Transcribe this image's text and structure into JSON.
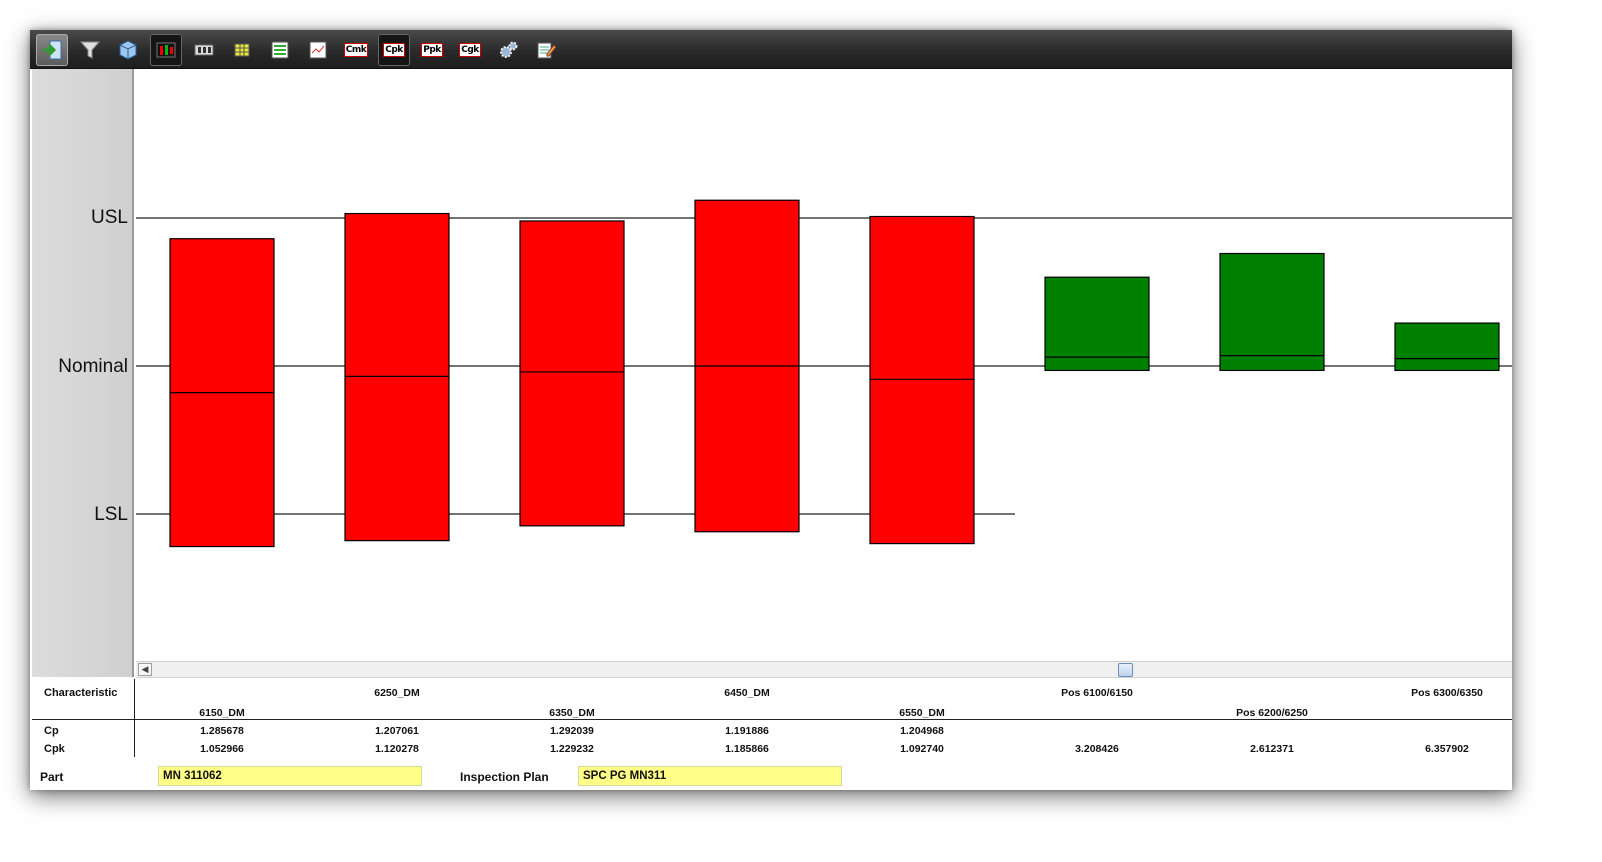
{
  "toolbar": {
    "buttons": [
      {
        "name": "exit-button",
        "icon": "exit-arrow-icon"
      },
      {
        "name": "filter-button",
        "icon": "funnel-icon"
      },
      {
        "name": "cube-button",
        "icon": "cube-icon"
      },
      {
        "name": "box-chart-button",
        "icon": "box-chart-icon"
      },
      {
        "name": "value-chart-button",
        "icon": "value-chart-icon"
      },
      {
        "name": "table-button",
        "icon": "table-icon"
      },
      {
        "name": "list-button",
        "icon": "list-icon"
      },
      {
        "name": "line-chart-button",
        "icon": "line-chart-icon"
      },
      {
        "name": "cmk-button",
        "icon": "cmk-icon",
        "text": "Cmk"
      },
      {
        "name": "cpk-button",
        "icon": "cpk-icon",
        "text": "Cpk"
      },
      {
        "name": "ppk-button",
        "icon": "ppk-icon",
        "text": "Ppk"
      },
      {
        "name": "cgk-button",
        "icon": "cgk-icon",
        "text": "Cgk"
      },
      {
        "name": "settings-button",
        "icon": "gears-icon"
      },
      {
        "name": "edit-button",
        "icon": "notepad-pencil-icon"
      }
    ]
  },
  "chart_data": {
    "type": "box",
    "y_reference_lines": [
      "USL",
      "Nominal",
      "LSL"
    ],
    "scale": {
      "USL": 1,
      "Nominal": 0,
      "LSL": -1
    },
    "colors": {
      "out_of_spec": "#ff0000",
      "in_spec": "#008000"
    },
    "boxes": [
      {
        "characteristic": "6150_DM",
        "low": -1.22,
        "high": 0.86,
        "center": -0.18,
        "status": "out_of_spec"
      },
      {
        "characteristic": "6250_DM",
        "low": -1.18,
        "high": 1.03,
        "center": -0.07,
        "status": "out_of_spec"
      },
      {
        "characteristic": "6350_DM",
        "low": -1.08,
        "high": 0.98,
        "center": -0.04,
        "status": "out_of_spec"
      },
      {
        "characteristic": "6450_DM",
        "low": -1.12,
        "high": 1.12,
        "center": 0.0,
        "status": "out_of_spec"
      },
      {
        "characteristic": "6550_DM",
        "low": -1.2,
        "high": 1.01,
        "center": -0.09,
        "status": "out_of_spec"
      },
      {
        "characteristic": "Pos 6100/6150",
        "low": -0.03,
        "high": 0.6,
        "center": 0.06,
        "status": "in_spec"
      },
      {
        "characteristic": "Pos 6200/6250",
        "low": -0.03,
        "high": 0.76,
        "center": 0.07,
        "status": "in_spec"
      },
      {
        "characteristic": "Pos 6300/6350",
        "low": -0.03,
        "high": 0.29,
        "center": 0.05,
        "status": "in_spec"
      }
    ],
    "lsl_extent_items": 5
  },
  "table": {
    "header_label": "Characteristic",
    "cp_label": "Cp",
    "cpk_label": "Cpk",
    "columns": [
      {
        "name": "6150_DM",
        "cp": "1.285678",
        "cpk": "1.052966"
      },
      {
        "name": "6250_DM",
        "cp": "1.207061",
        "cpk": "1.120278"
      },
      {
        "name": "6350_DM",
        "cp": "1.292039",
        "cpk": "1.229232"
      },
      {
        "name": "6450_DM",
        "cp": "1.191886",
        "cpk": "1.185866"
      },
      {
        "name": "6550_DM",
        "cp": "1.204968",
        "cpk": "1.092740"
      },
      {
        "name": "Pos 6100/6150",
        "cp": "",
        "cpk": "3.208426"
      },
      {
        "name": "Pos 6200/6250",
        "cp": "",
        "cpk": "2.612371"
      },
      {
        "name": "Pos 6300/6350",
        "cp": "",
        "cpk": "6.357902"
      }
    ]
  },
  "footer": {
    "part_label": "Part",
    "part_value": "MN 311062",
    "plan_label": "Inspection Plan",
    "plan_value": "SPC PG MN311"
  }
}
